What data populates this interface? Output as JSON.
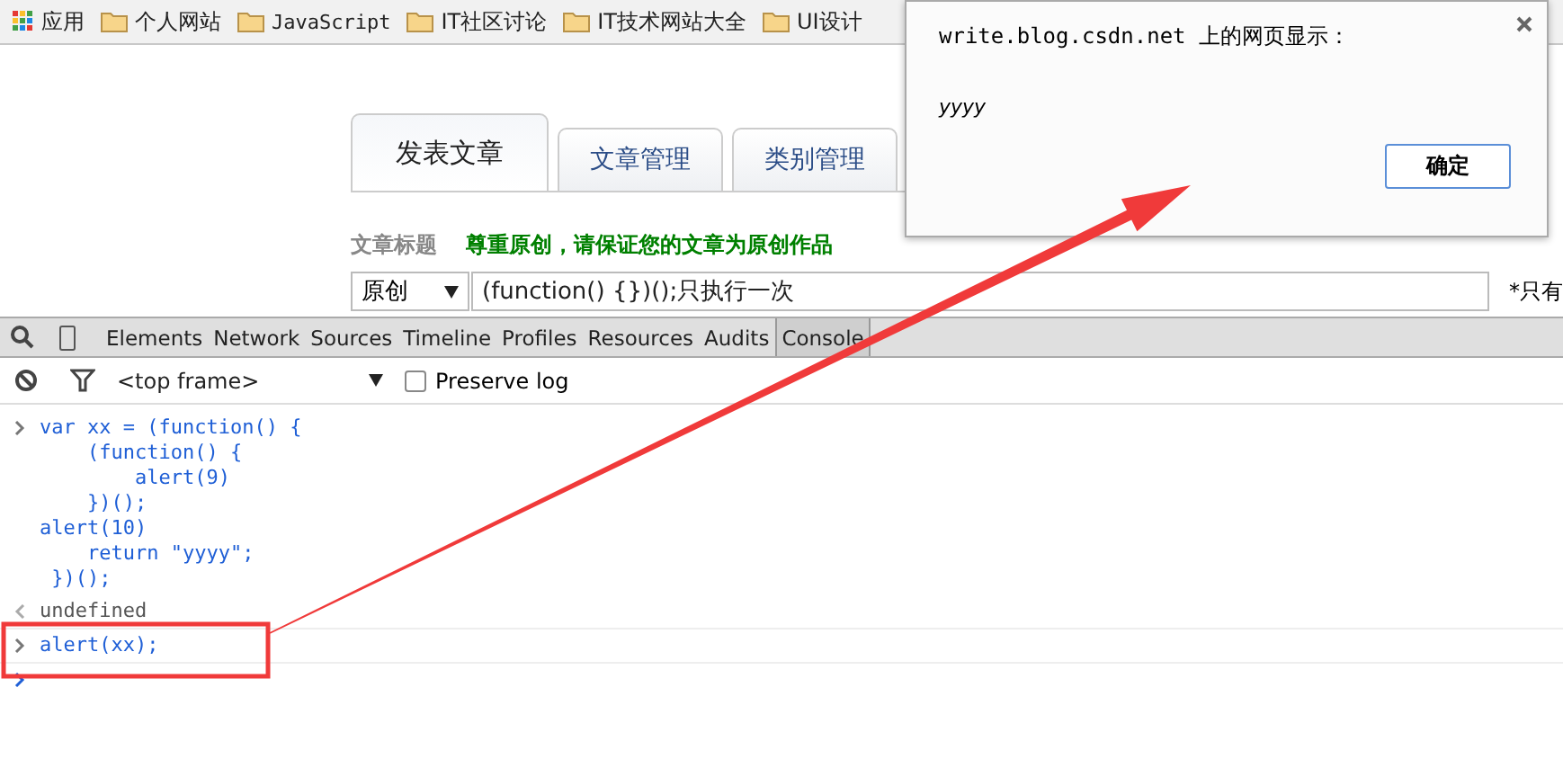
{
  "bookmarks_bar": {
    "items": [
      {
        "kind": "apps",
        "label": "应用"
      },
      {
        "kind": "folder",
        "label": "个人网站"
      },
      {
        "kind": "folder",
        "label": "JavaScript"
      },
      {
        "kind": "folder",
        "label": "IT社区讨论"
      },
      {
        "kind": "folder",
        "label": "IT技术网站大全"
      },
      {
        "kind": "folder",
        "label": "UI设计"
      }
    ]
  },
  "editor_tabs": [
    {
      "label": "发表文章",
      "selected": true
    },
    {
      "label": "文章管理",
      "selected": false
    },
    {
      "label": "类别管理",
      "selected": false
    }
  ],
  "title_row": {
    "label": "文章标题",
    "notice": "尊重原创，请保证您的文章为原创作品"
  },
  "title_input": {
    "type": "原创",
    "value": "(function() {})();只执行一次",
    "note": "*只有"
  },
  "devtools": {
    "panels": [
      {
        "label": "Elements",
        "selected": false
      },
      {
        "label": "Network",
        "selected": false
      },
      {
        "label": "Sources",
        "selected": false
      },
      {
        "label": "Timeline",
        "selected": false
      },
      {
        "label": "Profiles",
        "selected": false
      },
      {
        "label": "Resources",
        "selected": false
      },
      {
        "label": "Audits",
        "selected": false
      },
      {
        "label": "Console",
        "selected": true
      }
    ],
    "frame": "<top frame>",
    "preserve_log": {
      "label": "Preserve log",
      "checked": false
    },
    "console": [
      {
        "kind": "input",
        "text": "var xx = (function() {\n    (function() {\n        alert(9)\n    })();\nalert(10)\n    return \"yyyy\";\n })();"
      },
      {
        "kind": "result",
        "text": "undefined"
      },
      {
        "kind": "input",
        "text": "alert(xx);"
      },
      {
        "kind": "prompt"
      }
    ]
  },
  "dialog": {
    "title": "write.blog.csdn.net 上的网页显示：",
    "message": "yyyy",
    "button": "确定"
  }
}
